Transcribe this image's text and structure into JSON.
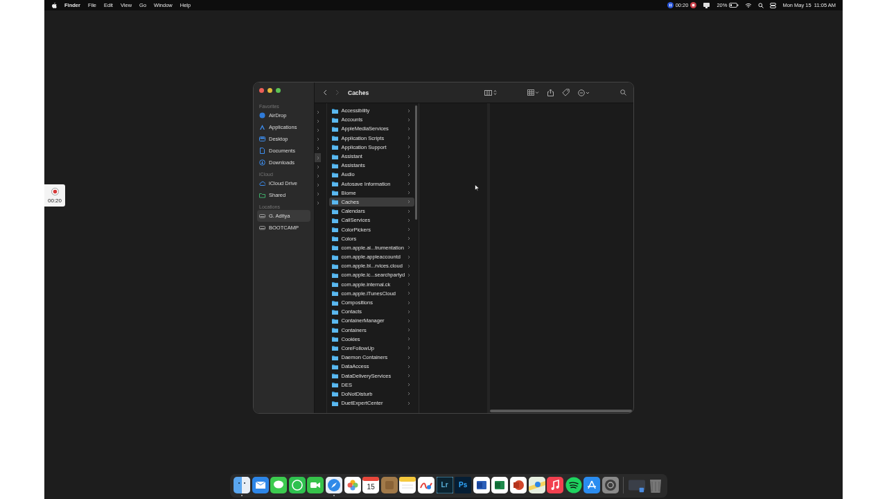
{
  "menubar": {
    "app": "Finder",
    "menus": [
      "File",
      "Edit",
      "View",
      "Go",
      "Window",
      "Help"
    ],
    "recording_time": "00:20",
    "battery": "20%",
    "clock": "Mon May 15  11:05 AM"
  },
  "recorder": {
    "time": "00:20"
  },
  "window": {
    "title": "Caches",
    "sidebar": [
      {
        "heading": "Favorites",
        "items": [
          {
            "label": "AirDrop",
            "kind": "airdrop",
            "selected": false
          },
          {
            "label": "Applications",
            "kind": "applications",
            "selected": false
          },
          {
            "label": "Desktop",
            "kind": "desktop",
            "selected": false
          },
          {
            "label": "Documents",
            "kind": "documents",
            "selected": false
          },
          {
            "label": "Downloads",
            "kind": "downloads",
            "selected": false
          }
        ]
      },
      {
        "heading": "iCloud",
        "items": [
          {
            "label": "iCloud Drive",
            "kind": "cloud",
            "selected": false
          },
          {
            "label": "Shared",
            "kind": "shared",
            "selected": false
          }
        ]
      },
      {
        "heading": "Locations",
        "items": [
          {
            "label": "G. Aditya",
            "kind": "disk",
            "selected": true
          },
          {
            "label": "BOOTCAMP",
            "kind": "disk",
            "selected": false
          }
        ]
      }
    ],
    "previous_column": [
      {
        "selected": false
      },
      {
        "selected": false
      },
      {
        "selected": false
      },
      {
        "selected": false
      },
      {
        "selected": false
      },
      {
        "selected": true
      },
      {
        "selected": false
      },
      {
        "selected": false
      },
      {
        "selected": false
      },
      {
        "selected": false
      },
      {
        "selected": false
      }
    ],
    "folders": [
      {
        "name": "Accessibility",
        "selected": false
      },
      {
        "name": "Accounts",
        "selected": false
      },
      {
        "name": "AppleMediaServices",
        "selected": false
      },
      {
        "name": "Application Scripts",
        "selected": false
      },
      {
        "name": "Application Support",
        "selected": false
      },
      {
        "name": "Assistant",
        "selected": false
      },
      {
        "name": "Assistants",
        "selected": false
      },
      {
        "name": "Audio",
        "selected": false
      },
      {
        "name": "Autosave Information",
        "selected": false
      },
      {
        "name": "Biome",
        "selected": false
      },
      {
        "name": "Caches",
        "selected": true
      },
      {
        "name": "Calendars",
        "selected": false
      },
      {
        "name": "CallServices",
        "selected": false
      },
      {
        "name": "ColorPickers",
        "selected": false
      },
      {
        "name": "Colors",
        "selected": false
      },
      {
        "name": "com.apple.ai...trumentation",
        "selected": false
      },
      {
        "name": "com.apple.appleaccountd",
        "selected": false
      },
      {
        "name": "com.apple.bl...rvices.cloud",
        "selected": false
      },
      {
        "name": "com.apple.ic...searchpartyd",
        "selected": false
      },
      {
        "name": "com.apple.internal.ck",
        "selected": false
      },
      {
        "name": "com.apple.iTunesCloud",
        "selected": false
      },
      {
        "name": "Compositions",
        "selected": false
      },
      {
        "name": "Contacts",
        "selected": false
      },
      {
        "name": "ContainerManager",
        "selected": false
      },
      {
        "name": "Containers",
        "selected": false
      },
      {
        "name": "Cookies",
        "selected": false
      },
      {
        "name": "CoreFollowUp",
        "selected": false
      },
      {
        "name": "Daemon Containers",
        "selected": false
      },
      {
        "name": "DataAccess",
        "selected": false
      },
      {
        "name": "DataDeliveryServices",
        "selected": false
      },
      {
        "name": "DES",
        "selected": false
      },
      {
        "name": "DoNotDisturb",
        "selected": false
      },
      {
        "name": "DuetExpertCenter",
        "selected": false
      }
    ]
  },
  "dock": {
    "apps": [
      {
        "kind": "finder",
        "running": true
      },
      {
        "kind": "mail",
        "running": false
      },
      {
        "kind": "messages",
        "running": false
      },
      {
        "kind": "whatsapp",
        "running": false
      },
      {
        "kind": "facetime",
        "running": false
      },
      {
        "kind": "safari",
        "running": true
      },
      {
        "kind": "photos",
        "running": false
      },
      {
        "kind": "calendar",
        "label": "15",
        "running": false
      },
      {
        "kind": "brown",
        "running": false
      },
      {
        "kind": "notes",
        "running": false
      },
      {
        "kind": "freeform",
        "running": false
      },
      {
        "kind": "lightroom",
        "label": "Lr",
        "running": false
      },
      {
        "kind": "photoshop",
        "label": "Ps",
        "running": false
      },
      {
        "kind": "word",
        "running": false
      },
      {
        "kind": "excel",
        "running": false
      },
      {
        "kind": "powerpoint",
        "running": false
      },
      {
        "kind": "maps",
        "running": false
      },
      {
        "kind": "music",
        "running": false
      },
      {
        "kind": "spotify",
        "running": false
      },
      {
        "kind": "appstore",
        "running": false
      },
      {
        "kind": "settings",
        "running": false
      },
      {
        "kind": "separator"
      },
      {
        "kind": "window-thumb",
        "running": false
      },
      {
        "kind": "trash",
        "running": false
      }
    ]
  }
}
